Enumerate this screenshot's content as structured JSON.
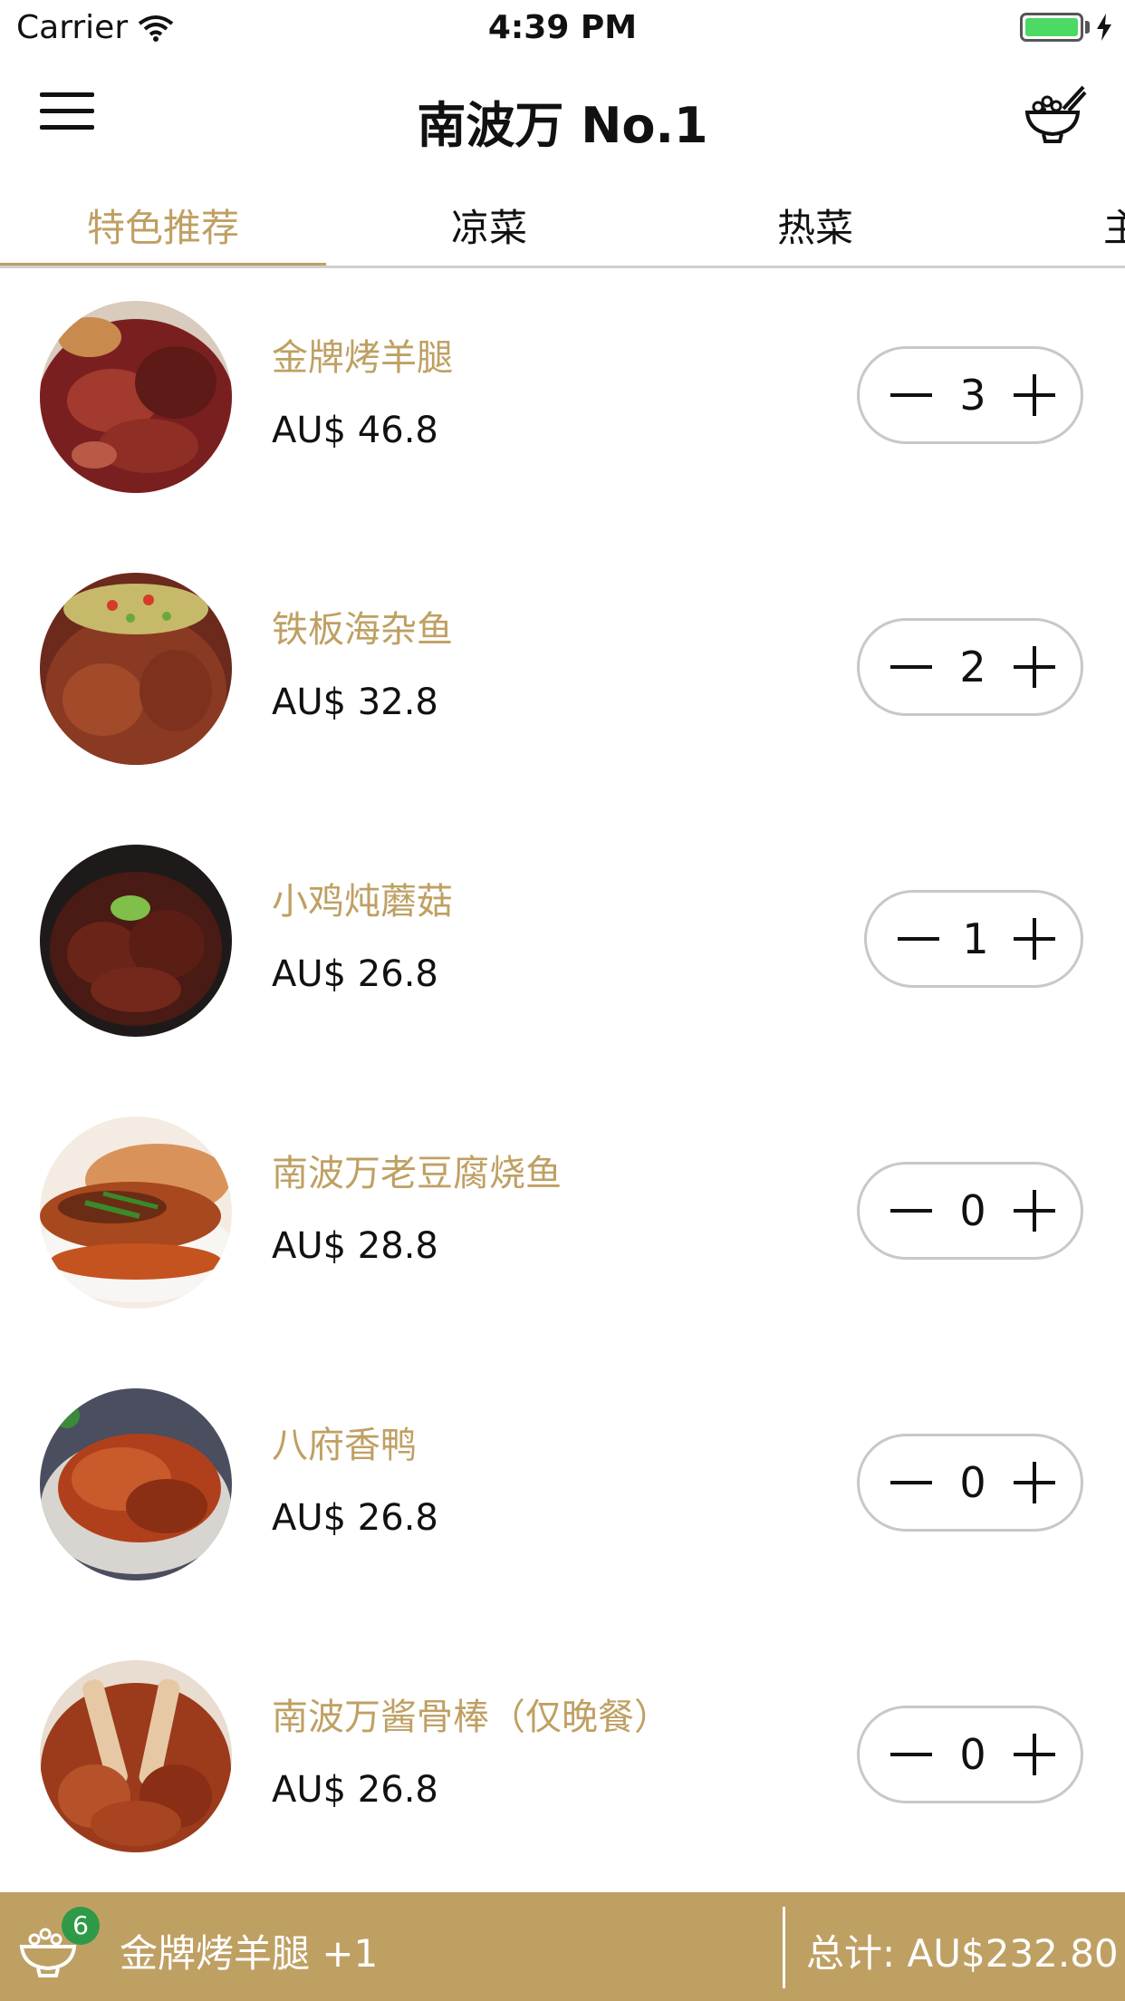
{
  "status_bar": {
    "carrier": "Carrier",
    "time": "4:39 PM",
    "battery_color": "#4cd964"
  },
  "nav": {
    "title": "南波万 No.1",
    "left_icon": "hamburger-menu-icon",
    "right_icon": "rice-bowl-icon"
  },
  "tabs": [
    {
      "label": "特色推荐",
      "active": true
    },
    {
      "label": "凉菜",
      "active": false
    },
    {
      "label": "热菜",
      "active": false
    },
    {
      "label": "主",
      "active": false
    }
  ],
  "dishes": [
    {
      "name": "金牌烤羊腿",
      "price": "AU$ 46.8",
      "quantity": "3",
      "minus": "—",
      "plus": "+"
    },
    {
      "name": "铁板海杂鱼",
      "price": "AU$ 32.8",
      "quantity": "2",
      "minus": "—",
      "plus": "+"
    },
    {
      "name": "小鸡炖蘑菇",
      "price": "AU$ 26.8",
      "quantity": "1",
      "minus": "—",
      "plus": "+"
    },
    {
      "name": "南波万老豆腐烧鱼",
      "price": "AU$ 28.8",
      "quantity": "0",
      "minus": "—",
      "plus": "+"
    },
    {
      "name": "八府香鸭",
      "price": "AU$ 26.8",
      "quantity": "0",
      "minus": "—",
      "plus": "+"
    },
    {
      "name": "南波万酱骨棒（仅晚餐）",
      "price": "AU$ 26.8",
      "quantity": "0",
      "minus": "—",
      "plus": "+"
    }
  ],
  "cart": {
    "badge_count": "6",
    "last_added": "金牌烤羊腿 +1",
    "total": "总计: AU$232.80"
  },
  "colors": {
    "accent": "#bfa063",
    "badge": "#2e9a47",
    "divider": "#cfcfcf"
  }
}
